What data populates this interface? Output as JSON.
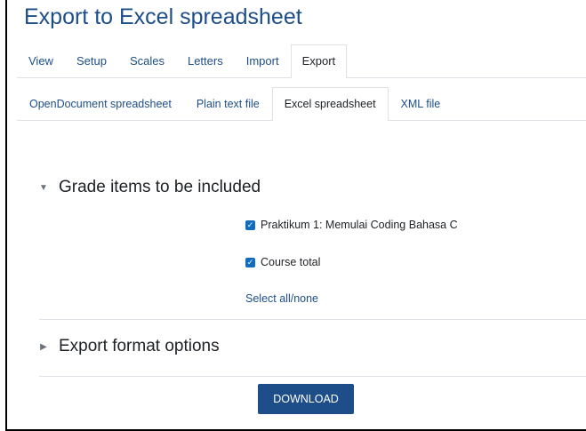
{
  "page": {
    "title": "Export to Excel spreadsheet"
  },
  "primary_tabs": [
    {
      "label": "View",
      "active": false
    },
    {
      "label": "Setup",
      "active": false
    },
    {
      "label": "Scales",
      "active": false
    },
    {
      "label": "Letters",
      "active": false
    },
    {
      "label": "Import",
      "active": false
    },
    {
      "label": "Export",
      "active": true
    }
  ],
  "secondary_tabs": [
    {
      "label": "OpenDocument spreadsheet",
      "active": false
    },
    {
      "label": "Plain text file",
      "active": false
    },
    {
      "label": "Excel spreadsheet",
      "active": true
    },
    {
      "label": "XML file",
      "active": false
    }
  ],
  "grade_items_section": {
    "title": "Grade items to be included",
    "expanded": true,
    "items": [
      {
        "label": "Praktikum 1: Memulai Coding Bahasa C",
        "checked": true
      },
      {
        "label": "Course total",
        "checked": true
      }
    ],
    "select_all_label": "Select all/none"
  },
  "export_format_section": {
    "title": "Export format options",
    "expanded": false
  },
  "download_button": {
    "label": "DOWNLOAD"
  },
  "colors": {
    "link": "#1d4e89",
    "button_bg": "#1d4e89",
    "checkbox": "#0f6cbf",
    "border": "#dee2e6",
    "text": "#1d2125"
  },
  "icons": {
    "expanded_caret": "caret-down-icon",
    "collapsed_caret": "caret-right-icon",
    "checkbox_check": "check-icon"
  }
}
